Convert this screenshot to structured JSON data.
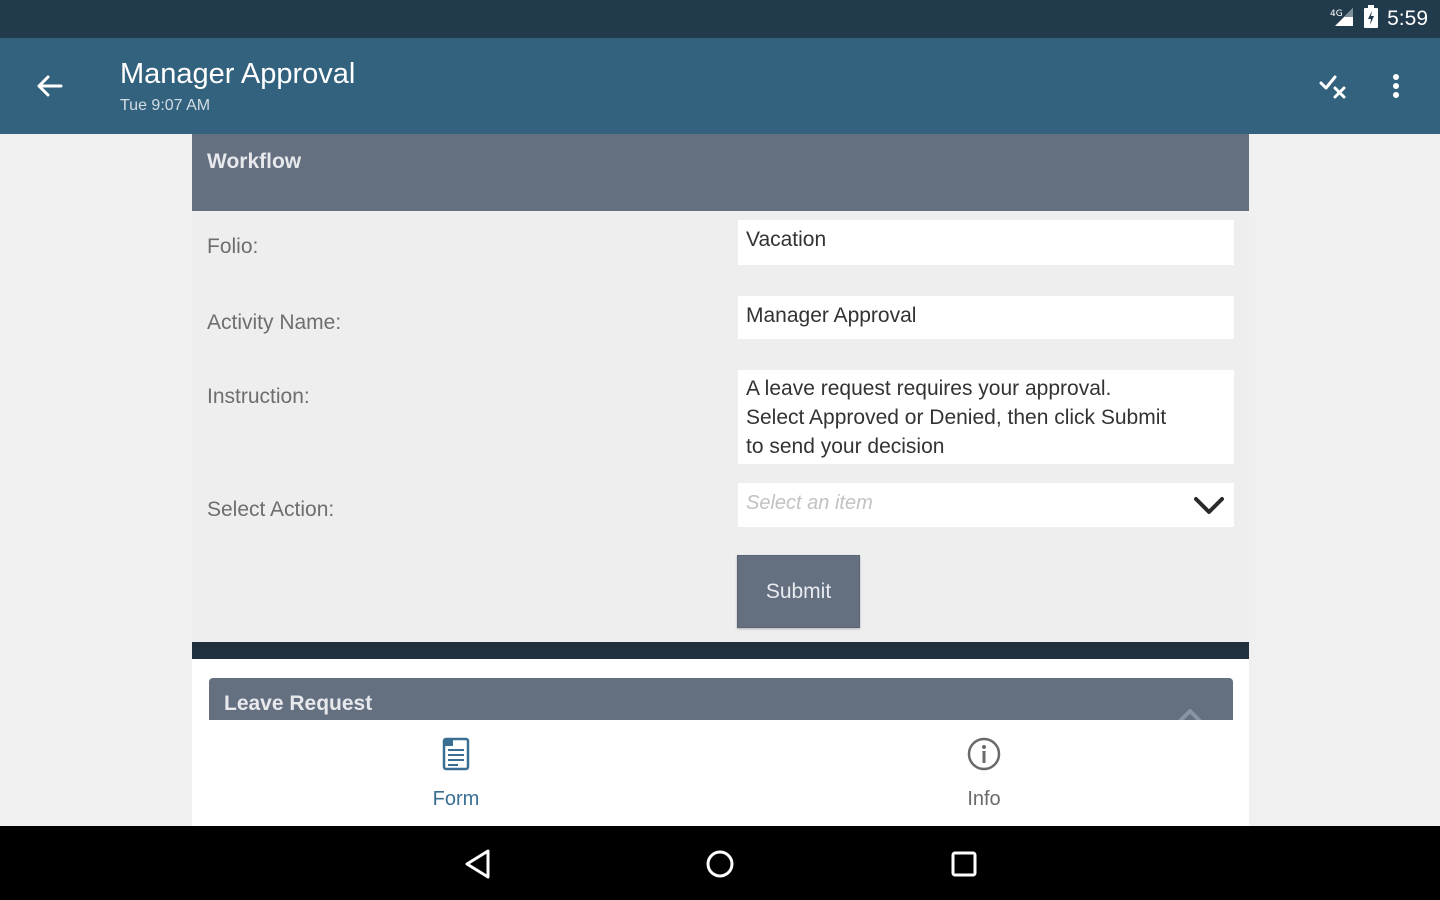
{
  "status_bar": {
    "time": "5:59"
  },
  "app_bar": {
    "title": "Manager Approval",
    "subtitle": "Tue 9:07 AM"
  },
  "workflow": {
    "title": "Workflow",
    "fields": {
      "folio_label": "Folio:",
      "folio_value": "Vacation",
      "activity_label": "Activity Name:",
      "activity_value": "Manager Approval",
      "instruction_label": "Instruction:",
      "instruction_line1": "A leave request requires your approval.",
      "instruction_line2": "Select Approved or Denied, then click Submit",
      "instruction_line3": "to send your decision",
      "action_label": "Select Action:",
      "action_placeholder": "Select an item"
    },
    "submit_label": "Submit"
  },
  "leave_request": {
    "title": "Leave Request"
  },
  "bottom_nav": {
    "items": [
      {
        "label": "Form",
        "icon": "form-icon",
        "active": true
      },
      {
        "label": "Info",
        "icon": "info-icon",
        "active": false
      }
    ]
  },
  "colors": {
    "status_bar": "#213b4c",
    "app_bar": "#33627f",
    "section_header": "#646f80",
    "active_tab": "#3a6f94",
    "inactive_tab": "#6a6a6a"
  }
}
